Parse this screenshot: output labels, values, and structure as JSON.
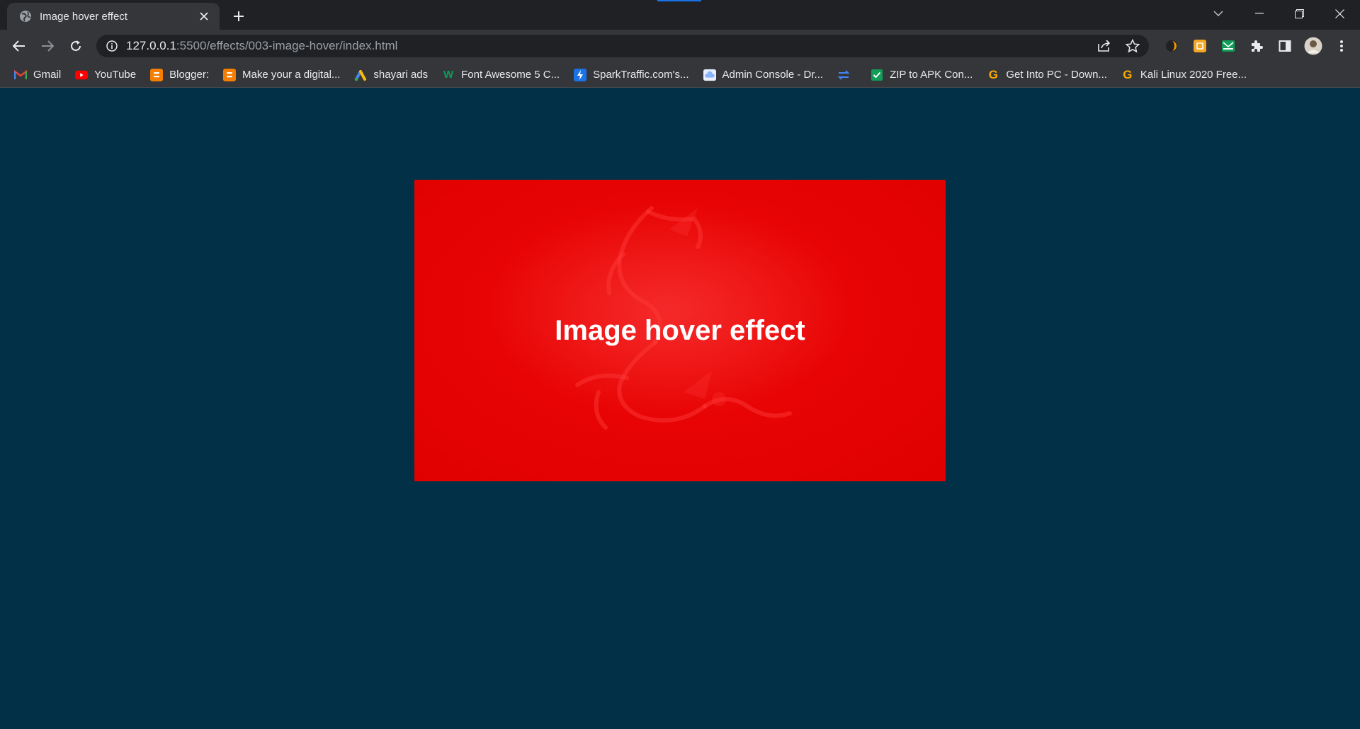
{
  "browser": {
    "tab": {
      "title": "Image hover effect"
    },
    "address": {
      "host": "127.0.0.1",
      "path": ":5500/effects/003-image-hover/index.html"
    },
    "bookmarks": [
      {
        "label": "Gmail",
        "icon": "gmail-icon",
        "color": "#ea4335",
        "glyph": "M"
      },
      {
        "label": "YouTube",
        "icon": "youtube-icon",
        "color": "#ff0000",
        "glyph": "▶"
      },
      {
        "label": "Blogger:",
        "icon": "blogger-icon",
        "color": "#f57d00",
        "glyph": "B"
      },
      {
        "label": "Make your a digital...",
        "icon": "blogger-icon",
        "color": "#f57d00",
        "glyph": "B"
      },
      {
        "label": "shayari ads",
        "icon": "google-ads-icon",
        "color": "#fbbc04",
        "glyph": "◢"
      },
      {
        "label": "Font Awesome 5 C...",
        "icon": "w-icon",
        "color": "#0f9d58",
        "glyph": "W"
      },
      {
        "label": "SparkTraffic.com's...",
        "icon": "lightning-icon",
        "color": "#1a73e8",
        "glyph": "⚡"
      },
      {
        "label": "Admin Console - Dr...",
        "icon": "cloud-icon",
        "color": "#8ab4f8",
        "glyph": "☁"
      },
      {
        "label": "",
        "icon": "transfer-icon",
        "color": "#4285f4",
        "glyph": "⇄"
      },
      {
        "label": "ZIP to APK Con...",
        "icon": "check-icon",
        "color": "#0f9d58",
        "glyph": "✓"
      },
      {
        "label": "Get Into PC - Down...",
        "icon": "g-icon",
        "color": "#f9ab00",
        "glyph": "G"
      },
      {
        "label": "Kali Linux 2020 Free...",
        "icon": "g-icon",
        "color": "#f9ab00",
        "glyph": "G"
      }
    ]
  },
  "page": {
    "background": "#023047",
    "card": {
      "heading": "Image hover effect",
      "color": "#e80404"
    }
  }
}
